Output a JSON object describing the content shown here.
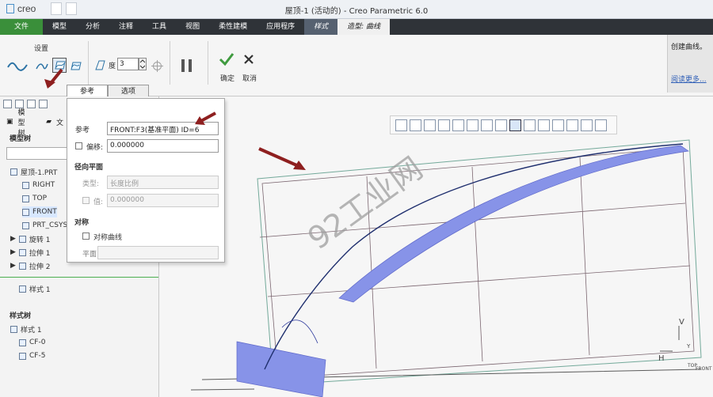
{
  "window": {
    "app_logo": "creo",
    "title": "屋顶-1 (活动的) - Creo Parametric 6.0"
  },
  "menu": {
    "items": [
      "文件",
      "模型",
      "分析",
      "注释",
      "工具",
      "视图",
      "柔性建模",
      "应用程序",
      "样式",
      "造型: 曲线"
    ]
  },
  "ribbon": {
    "group_label": "设置",
    "degree_label": "度",
    "degree_value": "3",
    "confirm_label": "确定",
    "cancel_label": "取消",
    "help_text": "创建曲线。",
    "help_link": "阅读更多..."
  },
  "popup": {
    "tabs": [
      "参考",
      "选项"
    ],
    "reference_label": "参考",
    "reference_value": "FRONT:F3(基准平面) ID=6",
    "offset_label": "偏移:",
    "offset_value": "0.000000",
    "radial_plane_section": "径向平面",
    "type_label": "类型:",
    "type_value": "长度比例",
    "value_label": "值:",
    "value_value": "0.000000",
    "symmetry_section": "对称",
    "symmetry_curve_label": "对称曲线",
    "plane_label": "平面"
  },
  "sidebar": {
    "tab_label": "模型树",
    "tab_label_2": "文",
    "model_tree_title": "模型树",
    "items": [
      "屋顶-1.PRT",
      "RIGHT",
      "TOP",
      "FRONT",
      "PRT_CSYS_",
      "旋转 1",
      "拉伸 1",
      "拉伸 2",
      "样式 1"
    ],
    "style_tree_title": "样式树",
    "style_items": [
      "样式 1",
      "CF-0",
      "CF-5"
    ]
  },
  "viewport": {
    "watermark": "92工业网",
    "axis_labels": [
      "V",
      "H",
      "Y",
      "TOP",
      "FRONT"
    ]
  },
  "colors": {
    "file_menu": "#3a8f3a",
    "menu_dark": "#2f3338",
    "accent_blue": "#5b73c8",
    "arrow_red": "#8e1f1f"
  }
}
